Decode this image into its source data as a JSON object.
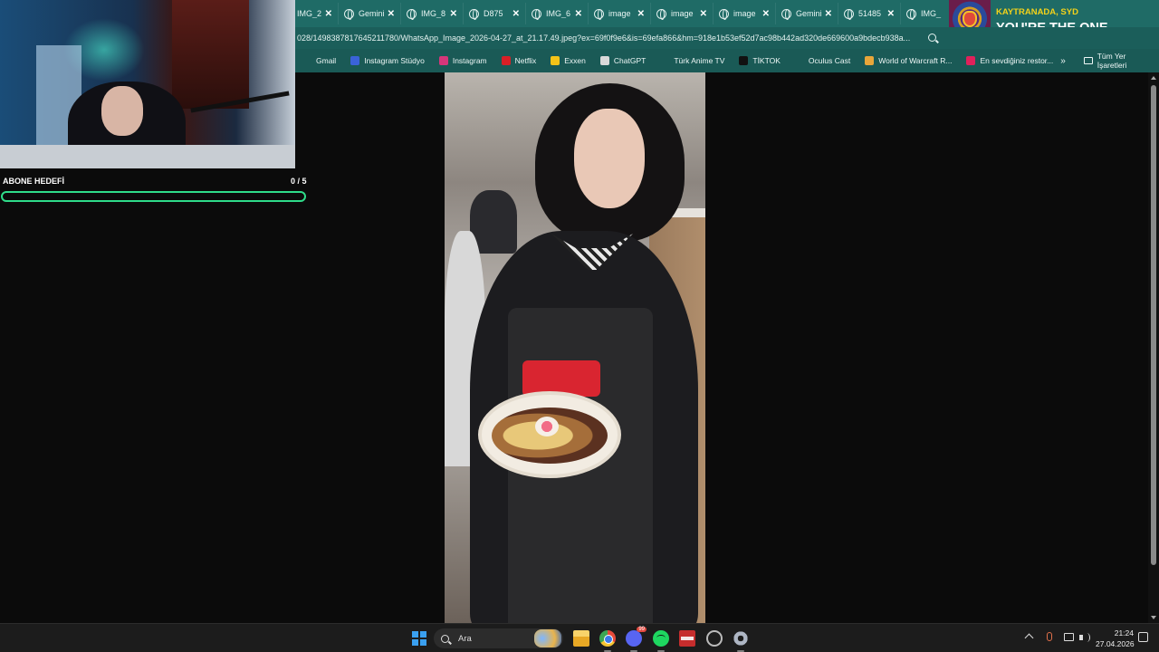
{
  "browser": {
    "tabs": [
      {
        "label": "IMG_2",
        "close": "✕"
      },
      {
        "label": "Gemini",
        "close": "✕"
      },
      {
        "label": "IMG_8",
        "close": "✕"
      },
      {
        "label": "D875",
        "close": "✕"
      },
      {
        "label": "IMG_6",
        "close": "✕"
      },
      {
        "label": "image",
        "close": "✕"
      },
      {
        "label": "image",
        "close": "✕"
      },
      {
        "label": "image",
        "close": "✕"
      },
      {
        "label": "Gemini",
        "close": "✕"
      },
      {
        "label": "51485",
        "close": "✕"
      },
      {
        "label": "IMG_",
        "close": ""
      }
    ],
    "url": "028/1498387817645211780/WhatsApp_Image_2026-04-27_at_21.17.49.jpeg?ex=69f0f9e6&is=69efa866&hm=918e1b53ef52d7ac98b442ad320de669600a9bdecb938a...",
    "bookmarks": [
      {
        "label": "Gmail",
        "color": "#1a5a56"
      },
      {
        "label": "Instagram Stüdyo",
        "color": "#3a63d8"
      },
      {
        "label": "Instagram",
        "color": "#d6367a"
      },
      {
        "label": "Netflix",
        "color": "#d81f26"
      },
      {
        "label": "Exxen",
        "color": "#f3c318"
      },
      {
        "label": "ChatGPT",
        "color": "#d9d9d9"
      },
      {
        "label": "Türk Anime TV",
        "color": "#1a5a56"
      },
      {
        "label": "TİKTOK",
        "color": "#111111"
      },
      {
        "label": "Oculus Cast",
        "color": "#1a5a56"
      },
      {
        "label": "World of Warcraft R...",
        "color": "#e9a63a"
      },
      {
        "label": "En sevdiğiniz restor...",
        "color": "#e0215b"
      }
    ],
    "more": "»",
    "all_bookmarks": "Tüm Yer İşaretleri"
  },
  "music": {
    "artist": "KAYTRANADA, SYD",
    "song": "YOU'RE THE ONE"
  },
  "sub_goal": {
    "label": "ABONE HEDEFİ",
    "count": "0 / 5",
    "progress": 0
  },
  "taskbar": {
    "search_placeholder": "Ara",
    "time": "21:24",
    "date": "27.04.2026"
  }
}
